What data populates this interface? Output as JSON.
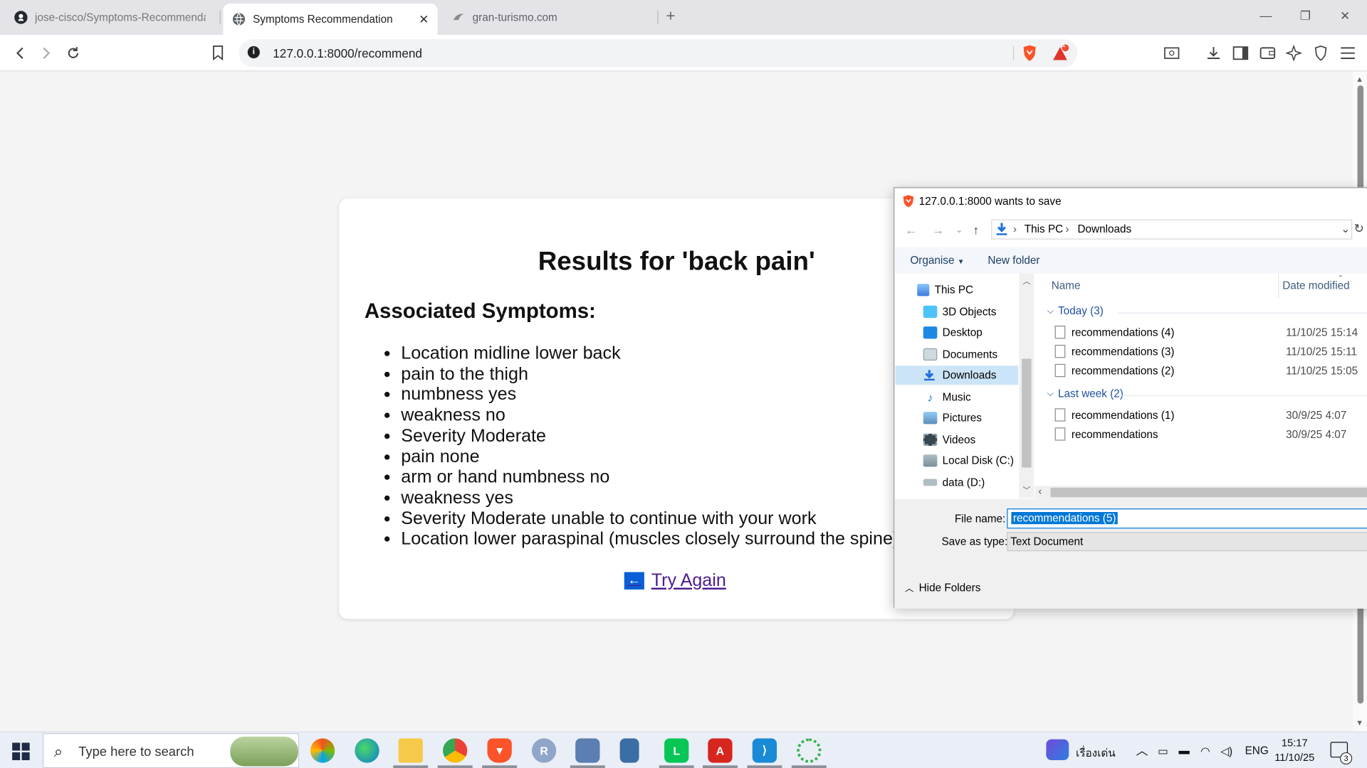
{
  "browser": {
    "tabs": [
      {
        "title": "jose-cisco/Symptoms-Recommendati",
        "icon": "github-icon"
      },
      {
        "title": "Symptoms Recommendation",
        "icon": "globe-icon"
      },
      {
        "title": "gran-turismo.com",
        "icon": "gt-icon"
      }
    ],
    "url": "127.0.0.1:8000/recommend",
    "brave_badge_count": "1"
  },
  "page": {
    "title": "Results for 'back pain'",
    "section_heading": "Associated Symptoms:",
    "symptoms": [
      "Location midline lower back",
      "pain to the thigh",
      "numbness yes",
      "weakness no",
      "Severity Moderate",
      "pain none",
      "arm or hand numbness no",
      "weakness yes",
      "Severity Moderate unable to continue with your work",
      "Location lower paraspinal (muscles closely surround the spine)"
    ],
    "try_again_label": "Try Again",
    "try_again_arrow": "←"
  },
  "save_dialog": {
    "title": "127.0.0.1:8000 wants to save",
    "breadcrumb": [
      "This PC",
      "Downloads"
    ],
    "organise_label": "Organise",
    "new_folder_label": "New folder",
    "nav_items": [
      {
        "label": "This PC",
        "icon": "pc-icon"
      },
      {
        "label": "3D Objects",
        "icon": "3d-objects-icon"
      },
      {
        "label": "Desktop",
        "icon": "desktop-icon"
      },
      {
        "label": "Documents",
        "icon": "documents-icon"
      },
      {
        "label": "Downloads",
        "icon": "downloads-icon",
        "selected": true
      },
      {
        "label": "Music",
        "icon": "music-icon"
      },
      {
        "label": "Pictures",
        "icon": "pictures-icon"
      },
      {
        "label": "Videos",
        "icon": "videos-icon"
      },
      {
        "label": "Local Disk (C:)",
        "icon": "local-disk-icon"
      },
      {
        "label": "data (D:)",
        "icon": "drive-icon"
      }
    ],
    "columns": {
      "name": "Name",
      "date_modified": "Date modified"
    },
    "groups": [
      {
        "label": "Today (3)",
        "files": [
          {
            "name": "recommendations (4)",
            "date": "11/10/25 15:14"
          },
          {
            "name": "recommendations (3)",
            "date": "11/10/25 15:11"
          },
          {
            "name": "recommendations (2)",
            "date": "11/10/25 15:05"
          }
        ]
      },
      {
        "label": "Last week (2)",
        "files": [
          {
            "name": "recommendations (1)",
            "date": "30/9/25 4:07"
          },
          {
            "name": "recommendations",
            "date": "30/9/25 4:07"
          }
        ]
      }
    ],
    "file_name_label": "File name:",
    "file_name_value": "recommendations (5)",
    "save_as_type_label": "Save as type:",
    "save_as_type_value": "Text Document",
    "hide_folders_label": "Hide Folders"
  },
  "taskbar": {
    "search_placeholder": "Type here to search",
    "apps": [
      "copilot-icon",
      "edge-icon",
      "file-explorer-icon",
      "chrome-icon",
      "brave-icon",
      "r-icon",
      "remote-desktop-icon",
      "calculator-icon",
      "line-icon",
      "acrobat-icon",
      "vscode-icon",
      "spinner-app-icon"
    ],
    "widget_text": "เรื่องเด่น",
    "language": "ENG",
    "time": "15:17",
    "date": "11/10/25",
    "notification_count": "3"
  },
  "colors": {
    "accent": "#0078d7",
    "link_visited": "#4c1b8f",
    "selection": "#cce4f7"
  }
}
